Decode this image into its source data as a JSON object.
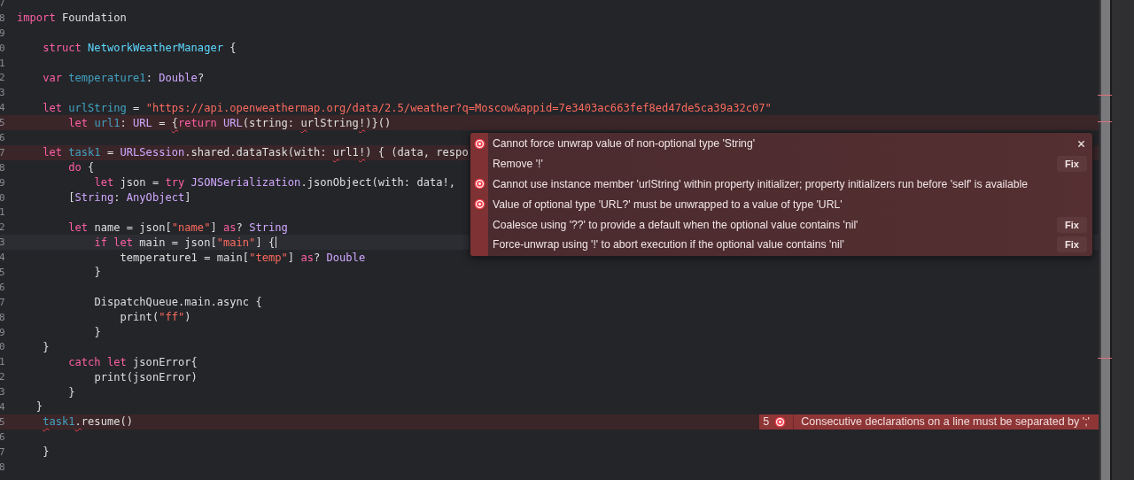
{
  "editor": {
    "lines": [
      {
        "number": "7",
        "error": false,
        "current": false
      },
      {
        "number": "8",
        "error": false,
        "current": false,
        "tokens": [
          {
            "text": "import",
            "kind": "keyword"
          },
          {
            "text": " Foundation",
            "kind": "plain"
          }
        ]
      },
      {
        "number": "9",
        "error": false,
        "current": false
      },
      {
        "number": "0",
        "error": false,
        "current": false,
        "tokens": [
          {
            "text": "    struct ",
            "kind": "keyword"
          },
          {
            "text": "NetworkWeatherManager",
            "kind": "typedecl"
          },
          {
            "text": " {",
            "kind": "plain"
          }
        ]
      },
      {
        "number": "1",
        "error": false,
        "current": false
      },
      {
        "number": "2",
        "error": false,
        "current": false,
        "tokens": [
          {
            "text": "    var ",
            "kind": "keyword"
          },
          {
            "text": "temperature1",
            "kind": "decl"
          },
          {
            "text": ": ",
            "kind": "plain"
          },
          {
            "text": "Double",
            "kind": "type"
          },
          {
            "text": "?",
            "kind": "plain"
          }
        ]
      },
      {
        "number": "3",
        "error": false,
        "current": false
      },
      {
        "number": "4",
        "error": false,
        "current": false,
        "tokens": [
          {
            "text": "    let ",
            "kind": "keyword"
          },
          {
            "text": "urlString",
            "kind": "decl"
          },
          {
            "text": " = ",
            "kind": "plain"
          },
          {
            "text": "\"https://api.openweathermap.org/data/2.5/weather?q=Moscow&appid=7e3403ac663fef8ed47de5ca39a32c07\"",
            "kind": "string"
          }
        ]
      },
      {
        "number": "5",
        "error": true,
        "current": false,
        "tokens": [
          {
            "text": "        let ",
            "kind": "keyword"
          },
          {
            "text": "url1",
            "kind": "decl"
          },
          {
            "text": ": ",
            "kind": "plain"
          },
          {
            "text": "URL",
            "kind": "type"
          },
          {
            "text": " = ",
            "kind": "plain"
          },
          {
            "text": "{",
            "kind": "plain",
            "squiggle": true
          },
          {
            "text": "return ",
            "kind": "keyword"
          },
          {
            "text": "URL",
            "kind": "type"
          },
          {
            "text": "(string: ",
            "kind": "plain"
          },
          {
            "text": "u",
            "kind": "plain",
            "squiggle": true
          },
          {
            "text": "rlString",
            "kind": "plain"
          },
          {
            "text": "!",
            "kind": "plain",
            "squiggle": true
          },
          {
            "text": ")}()",
            "kind": "plain"
          }
        ]
      },
      {
        "number": "6",
        "error": false,
        "current": false
      },
      {
        "number": "7",
        "error": true,
        "current": false,
        "tokens": [
          {
            "text": "    let ",
            "kind": "keyword"
          },
          {
            "text": "task1",
            "kind": "decl"
          },
          {
            "text": " = ",
            "kind": "plain"
          },
          {
            "text": "URLSession",
            "kind": "type"
          },
          {
            "text": ".shared.dataTask(with: ",
            "kind": "plain"
          },
          {
            "text": "u",
            "kind": "plain",
            "squiggle": true
          },
          {
            "text": "rl1",
            "kind": "plain"
          },
          {
            "text": "!",
            "kind": "plain",
            "squiggle": true
          },
          {
            "text": ") { (data, respo",
            "kind": "plain"
          }
        ]
      },
      {
        "number": "8",
        "error": false,
        "current": false,
        "tokens": [
          {
            "text": "        do",
            "kind": "keyword"
          },
          {
            "text": " {",
            "kind": "plain"
          }
        ]
      },
      {
        "number": "9",
        "error": false,
        "current": false,
        "tokens": [
          {
            "text": "            let",
            "kind": "keyword"
          },
          {
            "text": " json = ",
            "kind": "plain"
          },
          {
            "text": "try ",
            "kind": "keyword"
          },
          {
            "text": "JSONSerialization",
            "kind": "type"
          },
          {
            "text": ".jsonObject(with: data!,",
            "kind": "plain"
          }
        ]
      },
      {
        "number": "0",
        "error": false,
        "current": false,
        "tokens": [
          {
            "text": "        [",
            "kind": "plain"
          },
          {
            "text": "String",
            "kind": "type"
          },
          {
            "text": ": ",
            "kind": "plain"
          },
          {
            "text": "AnyObject",
            "kind": "type"
          },
          {
            "text": "]",
            "kind": "plain"
          }
        ]
      },
      {
        "number": "1",
        "error": false,
        "current": false
      },
      {
        "number": "2",
        "error": false,
        "current": false,
        "tokens": [
          {
            "text": "        let",
            "kind": "keyword"
          },
          {
            "text": " name = json[",
            "kind": "plain"
          },
          {
            "text": "\"name\"",
            "kind": "string"
          },
          {
            "text": "] ",
            "kind": "plain"
          },
          {
            "text": "as",
            "kind": "keyword"
          },
          {
            "text": "? ",
            "kind": "plain"
          },
          {
            "text": "String",
            "kind": "type"
          }
        ]
      },
      {
        "number": "3",
        "error": false,
        "current": true,
        "tokens": [
          {
            "text": "            if ",
            "kind": "keyword"
          },
          {
            "text": "let",
            "kind": "keyword"
          },
          {
            "text": " main = json[",
            "kind": "plain"
          },
          {
            "text": "\"main\"",
            "kind": "string"
          },
          {
            "text": "] {",
            "kind": "plain"
          }
        ]
      },
      {
        "number": "4",
        "error": false,
        "current": false,
        "tokens": [
          {
            "text": "                temperature1 = main[",
            "kind": "plain"
          },
          {
            "text": "\"temp\"",
            "kind": "string"
          },
          {
            "text": "] ",
            "kind": "plain"
          },
          {
            "text": "as",
            "kind": "keyword"
          },
          {
            "text": "? ",
            "kind": "plain"
          },
          {
            "text": "Double",
            "kind": "type"
          }
        ]
      },
      {
        "number": "5",
        "error": false,
        "current": false,
        "tokens": [
          {
            "text": "            }",
            "kind": "plain"
          }
        ]
      },
      {
        "number": "6",
        "error": false,
        "current": false
      },
      {
        "number": "7",
        "error": false,
        "current": false,
        "tokens": [
          {
            "text": "            DispatchQueue.main.async {",
            "kind": "plain"
          }
        ]
      },
      {
        "number": "8",
        "error": false,
        "current": false,
        "tokens": [
          {
            "text": "                print(",
            "kind": "plain"
          },
          {
            "text": "\"ff\"",
            "kind": "string"
          },
          {
            "text": ")",
            "kind": "plain"
          }
        ]
      },
      {
        "number": "9",
        "error": false,
        "current": false,
        "tokens": [
          {
            "text": "            }",
            "kind": "plain"
          }
        ]
      },
      {
        "number": "0",
        "error": false,
        "current": false,
        "tokens": [
          {
            "text": "    }",
            "kind": "plain"
          }
        ]
      },
      {
        "number": "1",
        "error": false,
        "current": false,
        "tokens": [
          {
            "text": "        catch ",
            "kind": "keyword"
          },
          {
            "text": "let",
            "kind": "keyword"
          },
          {
            "text": " jsonError{",
            "kind": "plain"
          }
        ]
      },
      {
        "number": "2",
        "error": false,
        "current": false,
        "tokens": [
          {
            "text": "            print(jsonError)",
            "kind": "plain"
          }
        ]
      },
      {
        "number": "3",
        "error": false,
        "current": false,
        "tokens": [
          {
            "text": "        }",
            "kind": "plain"
          }
        ]
      },
      {
        "number": "4",
        "error": false,
        "current": false,
        "tokens": [
          {
            "text": "   }",
            "kind": "plain"
          }
        ]
      },
      {
        "number": "5",
        "error": true,
        "current": false,
        "tokens": [
          {
            "text": "    t",
            "kind": "decl",
            "squiggle": true
          },
          {
            "text": "ask1",
            "kind": "decl"
          },
          {
            "text": ".",
            "kind": "plain",
            "squiggle": true
          },
          {
            "text": "resume()",
            "kind": "plain"
          }
        ],
        "annotation": {
          "count": "5",
          "message": "Consecutive declarations on a line must be separated by ';'"
        }
      },
      {
        "number": "6",
        "error": false,
        "current": false
      },
      {
        "number": "7",
        "error": false,
        "current": false,
        "tokens": [
          {
            "text": "    }",
            "kind": "plain"
          }
        ]
      },
      {
        "number": "8",
        "error": false,
        "current": false
      }
    ]
  },
  "issue_popover": {
    "items": [
      {
        "kind": "error",
        "text": "Cannot force unwrap value of non-optional type 'String'"
      },
      {
        "kind": "fixit",
        "text": "Remove '!'",
        "action": "Fix"
      },
      {
        "kind": "error",
        "text": "Cannot use instance member 'urlString' within property initializer; property initializers run before 'self' is available"
      },
      {
        "kind": "error",
        "text": "Value of optional type 'URL?' must be unwrapped to a value of type 'URL'"
      },
      {
        "kind": "fixit",
        "text": "Coalesce using '??' to provide a default when the optional value contains 'nil'",
        "action": "Fix"
      },
      {
        "kind": "fixit",
        "text": "Force-unwrap using '!' to abort execution if the optional value contains 'nil'",
        "action": "Fix"
      }
    ]
  }
}
